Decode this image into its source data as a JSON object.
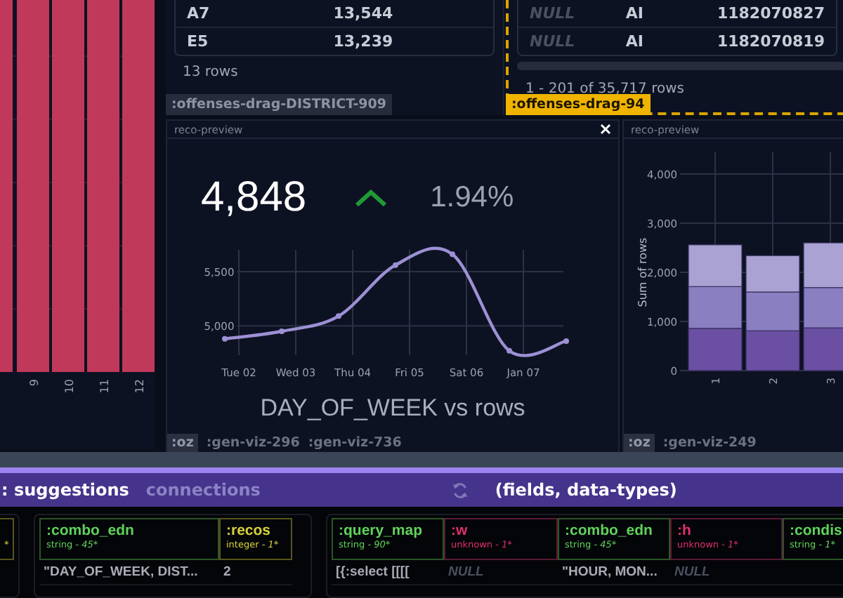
{
  "histogram": {
    "x_labels": [
      "9",
      "10",
      "11",
      "12"
    ]
  },
  "district_table": {
    "rows": [
      [
        "A7",
        "13,544"
      ],
      [
        "E5",
        "13,239"
      ]
    ],
    "footer": "13 rows",
    "tag": ":offenses-drag-DISTRICT-909"
  },
  "offenses_table": {
    "rows": [
      [
        {
          "text": "NULL",
          "is_null": true
        },
        {
          "text": "AI",
          "is_null": false
        },
        {
          "text": "1182070827",
          "is_null": false
        }
      ],
      [
        {
          "text": "NULL",
          "is_null": true
        },
        {
          "text": "AI",
          "is_null": false
        },
        {
          "text": "1182070819",
          "is_null": false
        }
      ]
    ],
    "footer": "1 - 201 of 35,717 rows",
    "tag": ":offenses-drag-94"
  },
  "preview_main": {
    "header": "reco-preview",
    "kpi": "4,848",
    "trend_up": true,
    "change": "1.94%",
    "title": "DAY_OF_WEEK vs rows",
    "tags": [
      ":oz",
      ":gen-viz-296",
      ":gen-viz-736"
    ],
    "chart_data": {
      "type": "line",
      "grid": true,
      "categories": [
        "Tue 02",
        "Wed 03",
        "Thu 04",
        "Fri 05",
        "Sat 06",
        "Jan 07",
        null
      ],
      "yticks": [
        {
          "value": 5000,
          "label": "5,000"
        },
        {
          "value": 5500,
          "label": "5,500"
        }
      ],
      "ylim": [
        4730,
        5700
      ],
      "series": [
        {
          "color": "#9d90d4",
          "marker": true,
          "values": [
            4880,
            4950,
            5090,
            5560,
            5660,
            4770,
            4860
          ]
        }
      ]
    }
  },
  "preview_side": {
    "header": "reco-preview",
    "tags": [
      ":oz",
      ":gen-viz-249"
    ],
    "chart_data": {
      "type": "bar",
      "stacked": true,
      "grid": true,
      "ylabel": "Sum of rows",
      "categories": [
        "1",
        "2",
        "3"
      ],
      "ylim": [
        0,
        4400
      ],
      "yticks": [
        {
          "value": 0,
          "label": "0"
        },
        {
          "value": 1000,
          "label": "1,000"
        },
        {
          "value": 2000,
          "label": "2,000"
        },
        {
          "value": 3000,
          "label": "3,000"
        },
        {
          "value": 4000,
          "label": "4,000"
        }
      ],
      "series": [
        {
          "color": "#6a4fa3",
          "values": [
            860,
            810,
            870
          ]
        },
        {
          "color": "#8a7fc1",
          "values": [
            850,
            790,
            820
          ]
        },
        {
          "color": "#aaa2d2",
          "values": [
            850,
            740,
            910
          ]
        }
      ]
    }
  },
  "bottom_tabs": [
    {
      "label": ": suggestions",
      "selected": true
    },
    {
      "label": "connections",
      "selected": false
    }
  ],
  "fields_label": "(fields, data-types)",
  "tables": [
    {
      "columns": [
        {
          "kind": "integer",
          "count": "*"
        }
      ]
    },
    {
      "columns": [
        {
          "kind": "string",
          "name": ":combo_edn",
          "type": "string -",
          "count": "45*"
        },
        {
          "kind": "integer",
          "name": ":recos",
          "type": "integer -",
          "count": "1*"
        }
      ],
      "rows": [
        [
          {
            "text": "\"DAY_OF_WEEK, DIST...",
            "is_null": false
          },
          {
            "text": "2",
            "is_null": false
          }
        ]
      ]
    },
    {
      "columns": [
        {
          "kind": "string",
          "name": ":query_map",
          "type": "string -",
          "count": "90*"
        },
        {
          "kind": "unknown",
          "name": ":w",
          "type": "unknown -",
          "count": "1*"
        },
        {
          "kind": "string",
          "name": ":combo_edn",
          "type": "string -",
          "count": "45*"
        },
        {
          "kind": "unknown",
          "name": ":h",
          "type": "unknown -",
          "count": "1*"
        },
        {
          "kind": "string",
          "name": ":condis",
          "type": "string -",
          "count": "1*"
        }
      ],
      "rows": [
        [
          {
            "text": "[{:select [[[[",
            "is_null": false
          },
          {
            "text": "NULL",
            "is_null": true
          },
          {
            "text": "\"HOUR, MON...",
            "is_null": false
          },
          {
            "text": "NULL",
            "is_null": true
          },
          null
        ]
      ]
    }
  ]
}
